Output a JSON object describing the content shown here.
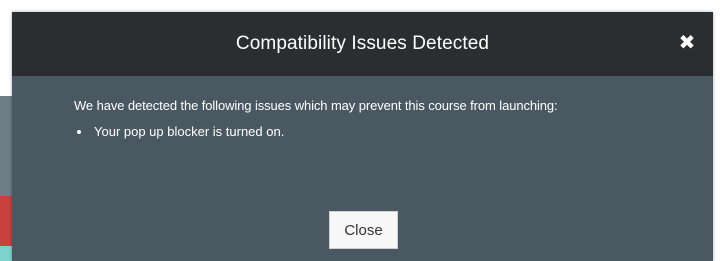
{
  "dialog": {
    "title": "Compatibility Issues Detected",
    "close_icon": "close-icon",
    "message": "We have detected the following issues which may prevent this course from launching:",
    "issues": [
      "Your pop up blocker is turned on."
    ],
    "close_button_label": "Close"
  },
  "colors": {
    "header_bg": "#2b2e31",
    "body_bg": "#4a5862",
    "button_bg": "#f7f7f7",
    "text": "#ffffff"
  }
}
